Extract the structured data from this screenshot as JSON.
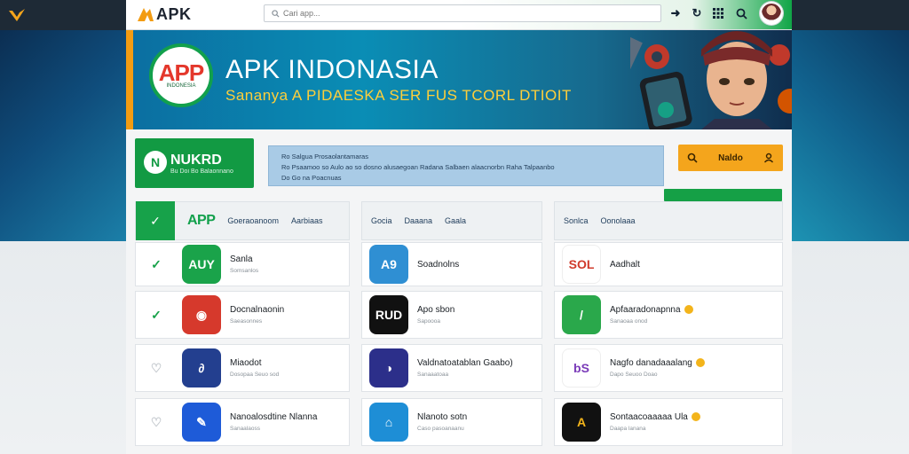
{
  "colors": {
    "accent_green": "#15a046",
    "accent_orange": "#f4a51c",
    "header_dark": "#1e2a36",
    "hero_blue": "#0a8db5",
    "notice_blue": "#a9cbe6"
  },
  "header": {
    "brand": "APK",
    "search_placeholder": "Cari app...",
    "icons": [
      "arrow-right-icon",
      "refresh-icon",
      "grid-icon",
      "search-icon"
    ]
  },
  "hero": {
    "logo_big": "APP",
    "logo_small": "INDONESIA",
    "title": "APK INDONASIA",
    "subtitle": "Sananya A PIDAESKA SER FUS TCORL DTIOIT"
  },
  "promo": {
    "icon": "N",
    "title": "NUKRD",
    "subtitle": "Bu Doi Bo Balaonnano"
  },
  "notice": {
    "line1": "Ro Salgua Prosaolantamaras",
    "line2": "Ro Psaamoo so Aulo ao so dosno alusaegoan Radana Salbaen alaacnorbn Raha Talpaanbo",
    "line3": "Do Go na Poacnuas"
  },
  "action_button": {
    "label": "Naldo",
    "icon": "user-icon"
  },
  "columns": [
    {
      "head": {
        "app": "APP",
        "tabs": [
          "Goeraoanoom",
          "Aarbiaas"
        ]
      },
      "cards": [
        {
          "icon_text": "AUY",
          "icon_color": "#1aa34a",
          "title": "Sanla",
          "sub": "Somsanlos",
          "check": "✓",
          "check_color": "#17a24a"
        },
        {
          "icon_text": "◉",
          "icon_color": "#d6392c",
          "title": "Docnalnaonin",
          "sub": "Saeasonnes",
          "check": "✓",
          "check_color": "#17a24a"
        },
        {
          "icon_text": "∂",
          "icon_color": "#233f8f",
          "title": "Miaodot",
          "sub": "Dosopaa Seuo sod",
          "check": "♡",
          "check_color": "#c4c9ce"
        },
        {
          "icon_text": "✎",
          "icon_color": "#1e5bd8",
          "title": "Nanoalosdtine Nlanna",
          "sub": "Sanaalaoss",
          "check": "♡",
          "check_color": "#c4c9ce"
        }
      ]
    },
    {
      "head": {
        "tabs": [
          "Gocia",
          "Daaana",
          "Gaala"
        ]
      },
      "cards": [
        {
          "icon_text": "A9",
          "icon_color": "#2f8fd3",
          "title": "Soadnolns",
          "sub": ""
        },
        {
          "icon_text": "RUD",
          "icon_color": "#111111",
          "title": "Apo sbon",
          "sub": "Sapoooa"
        },
        {
          "icon_text": "◑",
          "icon_color": "#2c2f8a",
          "title": "Valdnatoatablan Gaabo)",
          "sub": "Sanaaatoaa"
        },
        {
          "icon_text": "⌂",
          "icon_color": "#1e8ed6",
          "title": "Nlanoto sotn",
          "sub": "Caso pasoanaanu"
        }
      ]
    },
    {
      "head": {
        "tabs": [
          "Sonlca",
          "Oonolaaa"
        ]
      },
      "cards": [
        {
          "icon_text": "SOL",
          "icon_color": "#ffffff",
          "text_color": "#d03a2b",
          "title": "Aadhalt",
          "sub": "",
          "dot": false
        },
        {
          "icon_text": "/",
          "icon_color": "#2aa84b",
          "title": "Apfaaradonapnna",
          "sub": "Sanaoaa onod",
          "dot": true
        },
        {
          "icon_text": "bS",
          "icon_color": "#ffffff",
          "text_color": "#7a3ab8",
          "title": "Nagfo danadaaalang",
          "sub": "Dapo Seuoo Doao",
          "dot": true
        },
        {
          "icon_text": "A",
          "icon_color": "#111111",
          "text_color": "#f3b41b",
          "title": "Sontaacoaaaaa Ula",
          "sub": "Daapa lanana",
          "dot": true
        }
      ]
    }
  ]
}
